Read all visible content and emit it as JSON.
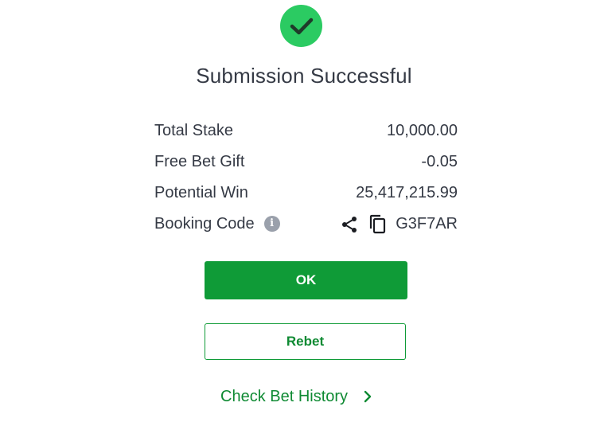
{
  "header": {
    "title": "Submission Successful"
  },
  "summary": {
    "rows": [
      {
        "label": "Total Stake",
        "value": "10,000.00"
      },
      {
        "label": "Free Bet Gift",
        "value": "-0.05"
      },
      {
        "label": "Potential Win",
        "value": "25,417,215.99"
      }
    ],
    "booking": {
      "label": "Booking Code",
      "code": "G3F7AR"
    }
  },
  "actions": {
    "ok_label": "OK",
    "rebet_label": "Rebet",
    "history_label": "Check Bet History"
  },
  "icons": {
    "success": "check-circle-icon",
    "info": "info-icon",
    "share": "share-icon",
    "copy": "copy-icon",
    "chevron": "chevron-right-icon"
  },
  "colors": {
    "accent_green": "#0f9b37",
    "success_green": "#2bcb62",
    "text": "#353a45",
    "info_grey": "#9aa0ab"
  }
}
